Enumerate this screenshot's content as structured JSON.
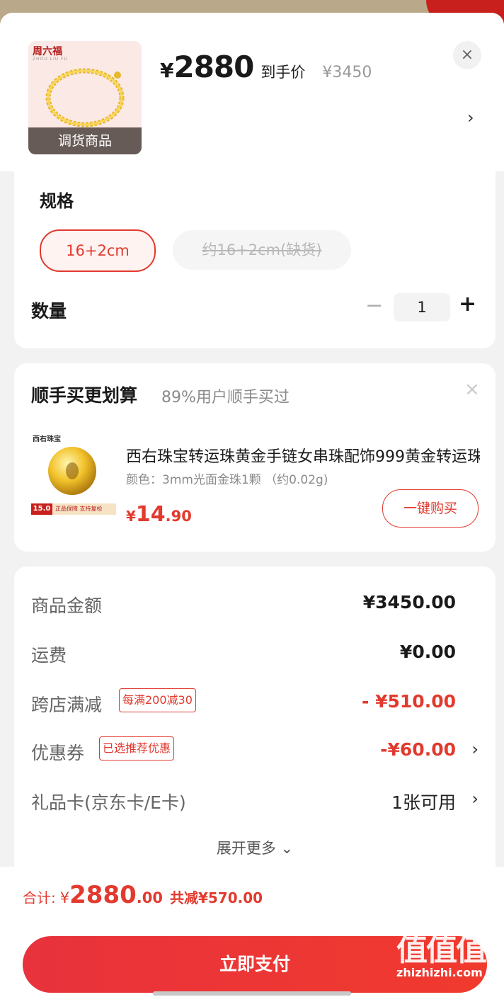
{
  "product": {
    "brand": "周六福",
    "brand_sub": "ZHOU LIU FU",
    "tag": "调货商品",
    "currency": "¥",
    "price": "2880",
    "price_label": "到手价",
    "original_price": "¥3450"
  },
  "icons": {
    "close": "×",
    "chevron": "›",
    "minus": "−",
    "plus": "+",
    "expand": "⌄"
  },
  "spec": {
    "title": "规格",
    "options": [
      {
        "label": "16+2cm",
        "selected": true
      },
      {
        "label": "约16+2cm(缺货)",
        "disabled": true
      }
    ]
  },
  "quantity": {
    "label": "数量",
    "value": "1"
  },
  "upsell": {
    "title": "顺手买更划算",
    "subtitle": "89%用户顺手买过",
    "item": {
      "brand": "西右珠宝",
      "name": "西右珠宝转运珠黄金手链女串珠配饰999黄金转运珠",
      "variant": "颜色：3mm光面金珠1颗 （约0.02g)",
      "price_yen": "¥",
      "price_int": "14",
      "price_dec": ".90",
      "thumb_badge": "15.0",
      "thumb_text": "正品保障 支持复检",
      "buy_label": "一键购买"
    }
  },
  "summary": {
    "rows": [
      {
        "label": "商品金额",
        "value": "¥3450.00"
      },
      {
        "label": "运费",
        "value": "¥0.00"
      },
      {
        "label": "跨店满减",
        "badge": "每满200减30",
        "value": "- ¥510.00"
      },
      {
        "label": "优惠券",
        "badge": "已选推荐优惠",
        "value": "-¥60.00"
      },
      {
        "label": "礼品卡(京东卡/E卡)",
        "value": "1张可用"
      }
    ],
    "expand_label": "展开更多"
  },
  "footer": {
    "total_label": "合计:",
    "total_yen": "¥",
    "total_int": "2880",
    "total_dec": ".00",
    "savings": "共减¥570.00",
    "pay_label": "立即支付"
  },
  "watermark": {
    "main": "值值值",
    "site": "zhizhizhi.com"
  },
  "colors": {
    "accent": "#e23a2e",
    "pay_button": "#f03a2e"
  }
}
